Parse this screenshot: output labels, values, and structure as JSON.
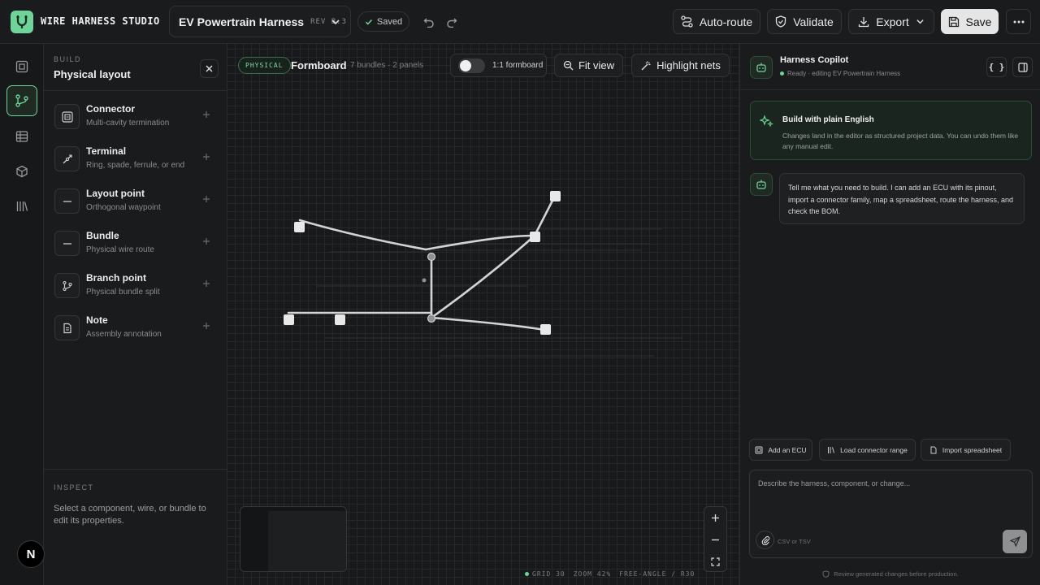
{
  "app": {
    "brand": "WIRE HARNESS STUDIO"
  },
  "project": {
    "name": "EV Powertrain Harness",
    "revision": "REV B.3"
  },
  "save_state": {
    "label": "Saved"
  },
  "toolbar": {
    "auto_route": "Auto-route",
    "validate": "Validate",
    "export": "Export",
    "save": "Save"
  },
  "build_panel": {
    "kicker": "BUILD",
    "title": "Physical layout",
    "components": [
      {
        "name": "Connector",
        "desc": "Multi-cavity termination",
        "icon": "connector-icon"
      },
      {
        "name": "Terminal",
        "desc": "Ring, spade, ferrule, or end",
        "icon": "terminal-icon"
      },
      {
        "name": "Layout point",
        "desc": "Orthogonal waypoint",
        "icon": "layout-point-icon"
      },
      {
        "name": "Bundle",
        "desc": "Physical wire route",
        "icon": "bundle-icon"
      },
      {
        "name": "Branch point",
        "desc": "Physical bundle split",
        "icon": "branch-icon"
      },
      {
        "name": "Note",
        "desc": "Assembly annotation",
        "icon": "note-icon"
      }
    ],
    "inspect_kicker": "INSPECT",
    "inspect_text": "Select a component, wire, or bundle to edit its properties."
  },
  "canvas": {
    "mode_badge": "PHYSICAL",
    "title": "Formboard",
    "meta": "7 bundles · 2 panels",
    "toggle_label": "1:1 formboard",
    "toggle_on": false,
    "fit_view": "Fit view",
    "highlight_nets": "Highlight nets",
    "status": {
      "grid": "GRID 30",
      "zoom": "ZOOM 42%",
      "mode": "FREE-ANGLE / R30"
    }
  },
  "copilot": {
    "title": "Harness Copilot",
    "status": "Ready · editing EV Powertrain Harness",
    "json_button": "{ }",
    "intro_title": "Build with plain English",
    "intro_text": "Changes land in the editor as structured project data. You can undo them like any manual edit.",
    "message": "Tell me what you need to build. I can add an ECU with its pinout, import a connector family, map a spreadsheet, route the harness, and check the BOM.",
    "chips": [
      "Add an ECU",
      "Load connector range",
      "Import spreadsheet"
    ],
    "input_placeholder": "Describe the harness, component, or change...",
    "attach_hint": "CSV or TSV",
    "footnote": "Review generated changes before production."
  },
  "user": {
    "initial": "N"
  },
  "colors": {
    "accent": "#6fd39a",
    "background": "#161718"
  }
}
